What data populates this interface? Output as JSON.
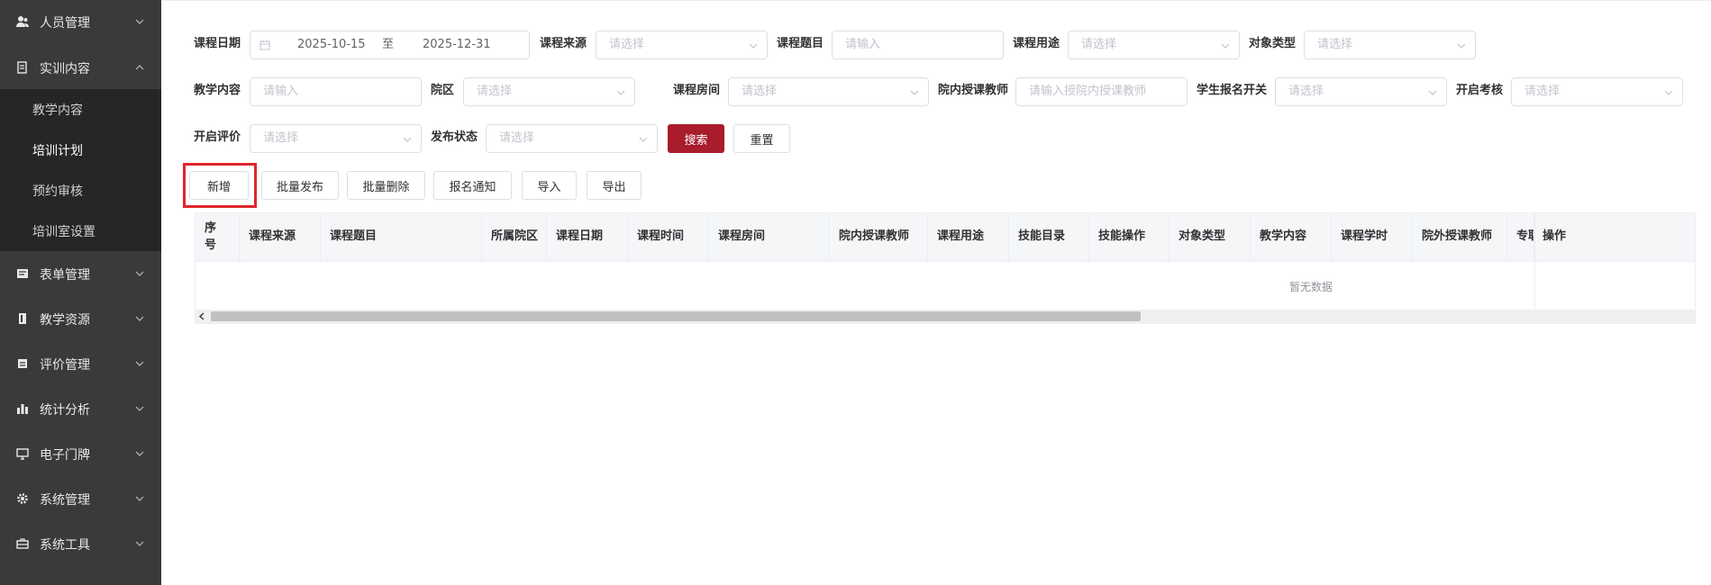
{
  "sidebar": {
    "menu": [
      {
        "label": "人员管理",
        "icon": "users-icon"
      },
      {
        "label": "实训内容",
        "icon": "document-icon"
      },
      {
        "label": "表单管理",
        "icon": "form-icon"
      },
      {
        "label": "教学资源",
        "icon": "book-icon"
      },
      {
        "label": "评价管理",
        "icon": "evaluation-icon"
      },
      {
        "label": "统计分析",
        "icon": "bar-chart-icon"
      },
      {
        "label": "电子门牌",
        "icon": "monitor-icon"
      },
      {
        "label": "系统管理",
        "icon": "gear-icon"
      },
      {
        "label": "系统工具",
        "icon": "toolbox-icon"
      }
    ],
    "submenu": [
      {
        "label": "教学内容"
      },
      {
        "label": "培训计划"
      },
      {
        "label": "预约审核"
      },
      {
        "label": "培训室设置"
      }
    ],
    "active_submenu": "培训计划"
  },
  "filters": {
    "course_date": {
      "label": "课程日期",
      "start": "2025-10-15",
      "sep": "至",
      "end": "2025-12-31"
    },
    "course_source": {
      "label": "课程来源",
      "placeholder": "请选择"
    },
    "course_topic": {
      "label": "课程题目",
      "placeholder": "请输入"
    },
    "course_purpose": {
      "label": "课程用途",
      "placeholder": "请选择"
    },
    "target_type": {
      "label": "对象类型",
      "placeholder": "请选择"
    },
    "teaching_content": {
      "label": "教学内容",
      "placeholder": "请输入"
    },
    "campus": {
      "label": "院区",
      "placeholder": "请选择"
    },
    "course_room": {
      "label": "课程房间",
      "placeholder": "请选择"
    },
    "internal_teacher": {
      "label": "院内授课教师",
      "placeholder": "请输入授院内授课教师"
    },
    "signup_switch": {
      "label": "学生报名开关",
      "placeholder": "请选择"
    },
    "enable_exam": {
      "label": "开启考核",
      "placeholder": "请选择"
    },
    "enable_eval": {
      "label": "开启评价",
      "placeholder": "请选择"
    },
    "publish_status": {
      "label": "发布状态",
      "placeholder": "请选择"
    },
    "search_label": "搜索",
    "reset_label": "重置"
  },
  "toolbar": {
    "add": "新增",
    "batch_publish": "批量发布",
    "batch_delete": "批量删除",
    "signup_notice": "报名通知",
    "import": "导入",
    "export": "导出"
  },
  "table": {
    "columns": [
      "序号",
      "课程来源",
      "课程题目",
      "所属院区",
      "课程日期",
      "课程时间",
      "课程房间",
      "院内授课教师",
      "课程用途",
      "技能目录",
      "技能操作",
      "对象类型",
      "教学内容",
      "课程学时",
      "院外授课教师",
      "专职",
      "操作"
    ],
    "empty_text": "暂无数据"
  },
  "colors": {
    "sidebar_bg": "#3a3a3a",
    "submenu_bg": "#262626",
    "primary": "#a81c2c",
    "highlight": "#e0262b"
  }
}
